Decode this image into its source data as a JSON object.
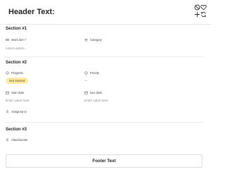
{
  "header": {
    "title": "Header Text:",
    "icons": [
      "block-icon",
      "heart-icon",
      "add-icon",
      "refresh-icon"
    ]
  },
  "sections": [
    {
      "title": "Section #1",
      "fields": [
        {
          "label": "Work item *",
          "icon": "text-field-icon",
          "value": "Lorem ipsum..."
        },
        {
          "label": "Category",
          "icon": "list-icon",
          "value": ""
        }
      ]
    },
    {
      "title": "Section #2",
      "fields": [
        {
          "label": "Progress",
          "icon": "status-icon",
          "value": "Not started"
        },
        {
          "label": "Priority",
          "icon": "status-icon",
          "value": "---"
        },
        {
          "label": "Start date",
          "icon": "calendar-icon",
          "value": "Enter value here"
        },
        {
          "label": "Due date",
          "icon": "calendar-icon",
          "value": "Enter value here"
        },
        {
          "label": "Assigned to",
          "icon": "person-icon",
          "value": ""
        }
      ]
    },
    {
      "title": "Section #3",
      "fields": [
        {
          "label": "Attachments",
          "icon": "attachment-icon",
          "value": ""
        }
      ]
    }
  ],
  "footer": {
    "text": "Footer Text"
  }
}
